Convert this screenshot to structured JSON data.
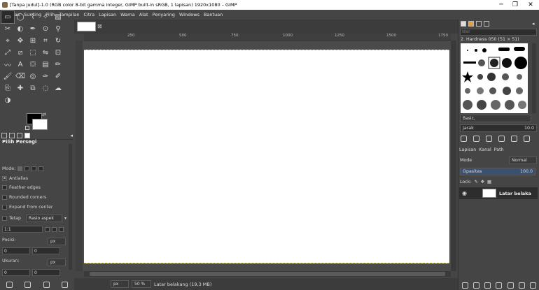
{
  "window": {
    "title": "[Tanpa judul]-1.0 (RGB color 8-bit gamma integer, GIMP built-in sRGB, 1 lapisan) 1920x1080 – GIMP",
    "minimize": "─",
    "maximize": "❐",
    "close": "✕"
  },
  "menu": [
    "Berkas",
    "Sunting",
    "Pilih",
    "Tampilan",
    "Citra",
    "Lapisan",
    "Warna",
    "Alat",
    "Penyaring",
    "Windows",
    "Bantuan"
  ],
  "toolbox": {
    "tools": [
      "rect-select",
      "ellipse-select",
      "free-select",
      "fuzzy-select",
      "select-by-color",
      "scissors",
      "foreground-select",
      "paths",
      "color-picker",
      "zoom",
      "measure",
      "move",
      "alignment",
      "crop",
      "rotate",
      "scale",
      "shear",
      "perspective",
      "flip",
      "cage",
      "warp",
      "text",
      "bucket-fill",
      "gradient",
      "pencil",
      "paintbrush",
      "eraser",
      "airbrush",
      "ink",
      "mypaint",
      "clone",
      "heal",
      "perspective-clone",
      "blur",
      "smudge",
      "dodge"
    ],
    "options": {
      "title": "Pilih Persegi",
      "mode_label": "Mode:",
      "antialias": "Antialias",
      "feather": "Feather edges",
      "rounded": "Rounded corners",
      "expand": "Expand from center",
      "fixed": "Tetap",
      "fixed_value": "Rasio aspek",
      "ratio": "1:1",
      "position_label": "Posisi:",
      "position_unit": "px",
      "position_x": "0",
      "position_y": "0",
      "size_label": "Ukuran:",
      "size_unit": "px",
      "size_w": "0",
      "size_h": "0"
    }
  },
  "rulers": {
    "ticks": [
      "250",
      "500",
      "750",
      "1000",
      "1250",
      "1500",
      "1750"
    ]
  },
  "status": {
    "unit": "px",
    "zoom": "50 %",
    "message": "Latar belakang (19,3 MB)"
  },
  "dock": {
    "filter_placeholder": "filter",
    "brush_name": "2. Hardness 050 (51 × 51)",
    "tag": "Basic,",
    "spacing_label": "Jarak",
    "spacing_value": "10.0",
    "tabs": [
      "Lapisan",
      "Kanal",
      "Path"
    ],
    "mode_label": "Mode",
    "mode_value": "Normal",
    "opacity_label": "Opasitas",
    "opacity_value": "100.0",
    "lock_label": "Lock:",
    "layer_name": "Latar belaka"
  }
}
